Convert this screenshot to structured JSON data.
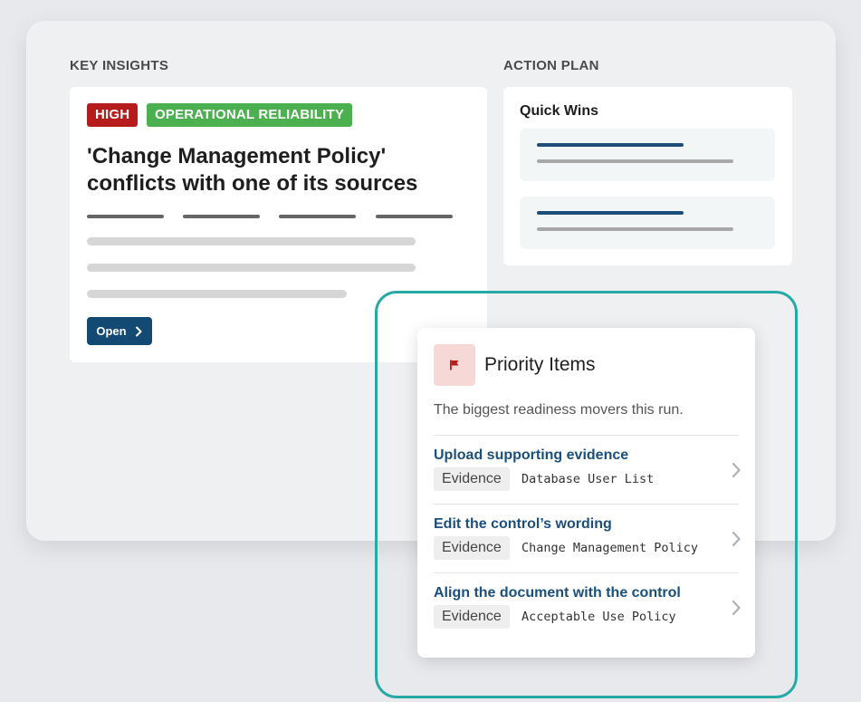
{
  "key_insights": {
    "heading": "KEY INSIGHTS",
    "card": {
      "badges": {
        "severity": "HIGH",
        "category": "OPERATIONAL RELIABILITY"
      },
      "title": "'Change Management Policy' conflicts with one of its sources",
      "open_button_label": "Open"
    }
  },
  "action_plan": {
    "heading": "ACTION PLAN",
    "card_title": "Quick Wins"
  },
  "priority_items": {
    "title": "Priority Items",
    "subtitle": "The biggest readiness movers this run.",
    "items": [
      {
        "title": "Upload supporting evidence",
        "tag": "Evidence",
        "document": "Database User List"
      },
      {
        "title": "Edit the control’s wording",
        "tag": "Evidence",
        "document": "Change Management Policy"
      },
      {
        "title": "Align the document with the control",
        "tag": "Evidence",
        "document": "Acceptable Use Policy"
      }
    ]
  },
  "colors": {
    "high_badge": "#b71c1c",
    "category_badge": "#4caf50",
    "primary_button": "#124a73",
    "highlight_border": "#27aaa6",
    "link_text": "#1b4f7b",
    "flag_tile_bg": "#f6d8d6",
    "flag": "#b71c1c"
  },
  "icons": {
    "priority": "flag-icon",
    "open": "chevron-right-icon",
    "item_arrow": "chevron-right-icon"
  }
}
